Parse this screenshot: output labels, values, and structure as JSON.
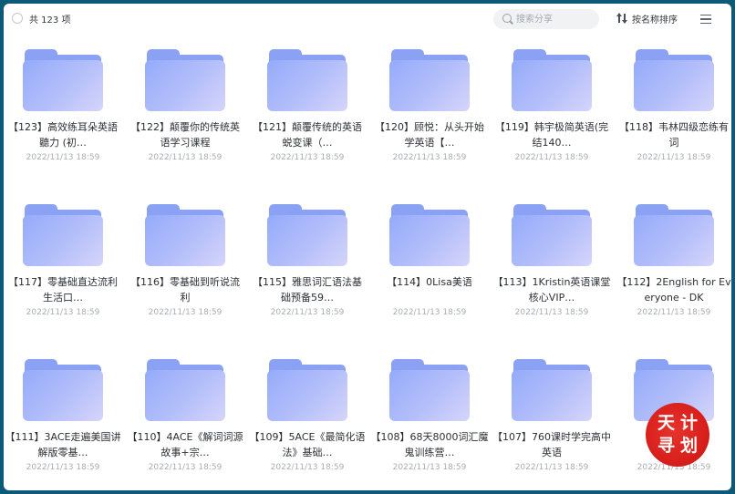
{
  "header": {
    "count_label": "共 123 项",
    "search_placeholder": "搜索分享",
    "sort_label": "按名称排序"
  },
  "icons": {
    "select": "circle-checkbox-icon",
    "search": "search-icon",
    "sort": "sort-arrows-icon",
    "menu": "hamburger-menu-icon",
    "folder": "folder-icon"
  },
  "colors": {
    "folder_tab": "#8ba1f3",
    "folder_front_start": "#94abfa",
    "folder_front_end": "#d6d5fb",
    "stamp": "#d8201c"
  },
  "folders": [
    {
      "name": "【123】高效练耳朵英語聽力 (初…",
      "date": "2022/11/13 18:59"
    },
    {
      "name": "【122】颠覆你的传统英语学习课程",
      "date": "2022/11/13 18:59"
    },
    {
      "name": "【121】颠覆传统的英语蜕变课（…",
      "date": "2022/11/13 18:59"
    },
    {
      "name": "【120】顾悦：从头开始学英语【…",
      "date": "2022/11/13 18:59"
    },
    {
      "name": "【119】韩宇极简英语(完结140…",
      "date": "2022/11/13 18:59"
    },
    {
      "name": "【118】韦林四级恋练有词",
      "date": "2022/11/13 18:59"
    },
    {
      "name": "【117】零基础直达流利生活口…",
      "date": "2022/11/13 18:59"
    },
    {
      "name": "【116】零基础到听说流利",
      "date": "2022/11/13 18:59"
    },
    {
      "name": "【115】雅思词汇语法基础预备59…",
      "date": "2022/11/13 18:59"
    },
    {
      "name": "【114】0Lisa美语",
      "date": "2022/11/13 18:59"
    },
    {
      "name": "【113】1Kristin英语课堂核心VIP…",
      "date": "2022/11/13 18:59"
    },
    {
      "name": "【112】2English for Everyone - DK",
      "date": "2022/11/13 18:59"
    },
    {
      "name": "【111】3ACE走遍美国讲解版零基…",
      "date": "2022/11/13 18:59"
    },
    {
      "name": "【110】4ACE《解词词源故事+宗…",
      "date": "2022/11/13 18:59"
    },
    {
      "name": "【109】5ACE《最简化语法》基础…",
      "date": "2022/11/13 18:59"
    },
    {
      "name": "【108】68天8000词汇魔鬼训练营…",
      "date": "2022/11/13 18:59"
    },
    {
      "name": "【107】760课时学完高中英语",
      "date": "2022/11/13 18:59"
    },
    {
      "name": "【1",
      "date": "2022/11/13 18:59"
    }
  ],
  "watermark": {
    "chars": [
      "天",
      "计",
      "寻",
      "划"
    ]
  }
}
